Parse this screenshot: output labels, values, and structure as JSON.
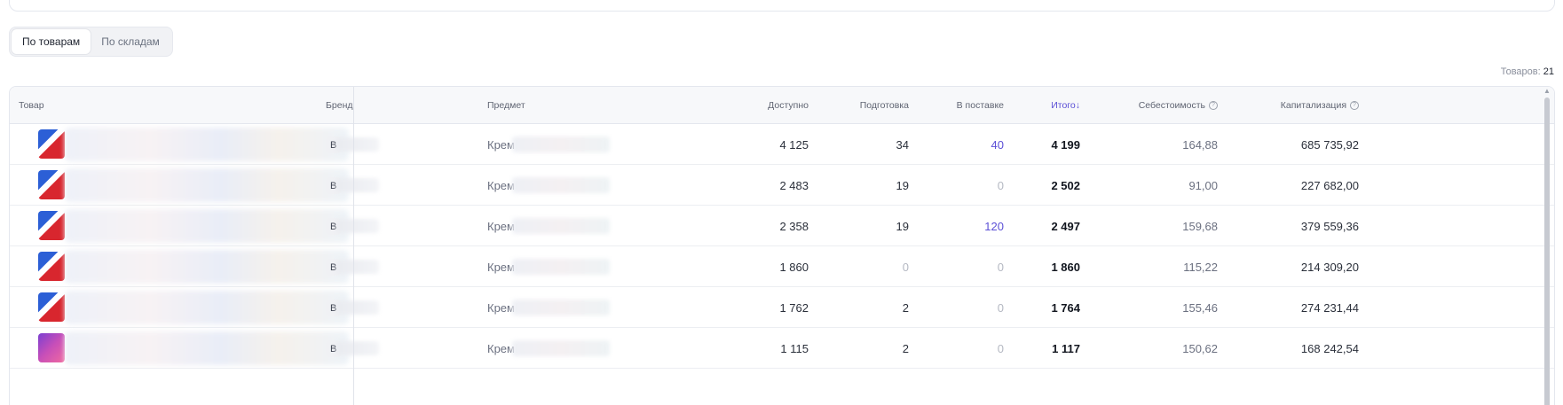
{
  "tabs": [
    {
      "label": "По товарам",
      "active": true
    },
    {
      "label": "По складам",
      "active": false
    }
  ],
  "count": {
    "label": "Товаров:",
    "value": "21"
  },
  "columns": {
    "product": "Товар",
    "brand": "Бренд",
    "subject": "Предмет",
    "available": "Доступно",
    "preparing": "Подготовка",
    "in_supply": "В поставке",
    "total": "Итого↓",
    "cost": "Себестоимость",
    "capitalization": "Капитализация",
    "help_glyph": "?"
  },
  "rows": [
    {
      "brand": "В",
      "subject": "Крем",
      "available": "4 125",
      "preparing": "34",
      "in_supply": "40",
      "total": "4 199",
      "cost": "164,88",
      "capitalization": "685 735,92"
    },
    {
      "brand": "В",
      "subject": "Крем",
      "available": "2 483",
      "preparing": "19",
      "in_supply": "0",
      "total": "2 502",
      "cost": "91,00",
      "capitalization": "227 682,00"
    },
    {
      "brand": "В",
      "subject": "Крем",
      "available": "2 358",
      "preparing": "19",
      "in_supply": "120",
      "total": "2 497",
      "cost": "159,68",
      "capitalization": "379 559,36"
    },
    {
      "brand": "В",
      "subject": "Крем",
      "available": "1 860",
      "preparing": "0",
      "in_supply": "0",
      "total": "1 860",
      "cost": "115,22",
      "capitalization": "214 309,20"
    },
    {
      "brand": "В",
      "subject": "Крем",
      "available": "1 762",
      "preparing": "2",
      "in_supply": "0",
      "total": "1 764",
      "cost": "155,46",
      "capitalization": "274 231,44"
    },
    {
      "brand": "В",
      "subject": "Крем",
      "available": "1 115",
      "preparing": "2",
      "in_supply": "0",
      "total": "1 117",
      "cost": "150,62",
      "capitalization": "168 242,54"
    }
  ],
  "colors": {
    "accent": "#5b4fd6",
    "muted": "#b4b8c2"
  }
}
